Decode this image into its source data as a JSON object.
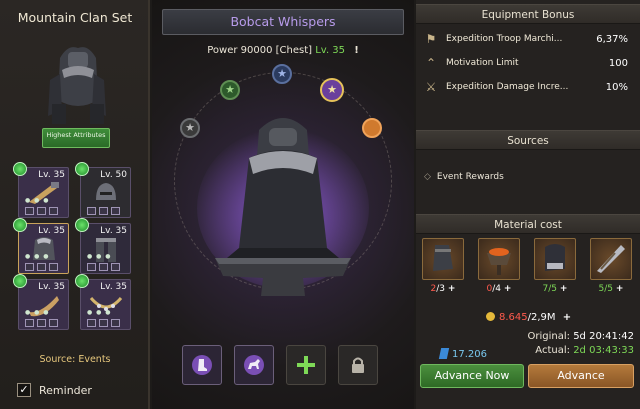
{
  "left": {
    "title": "Mountain Clan Set",
    "highest_attributes": "Highest Attributes",
    "slots": [
      {
        "level": "Lv. 35"
      },
      {
        "level": "Lv. 50"
      },
      {
        "level": "Lv. 35"
      },
      {
        "level": "Lv. 35"
      },
      {
        "level": "Lv. 35"
      },
      {
        "level": "Lv. 35"
      }
    ],
    "source": "Source: Events",
    "reminder": "Reminder"
  },
  "center": {
    "name": "Bobcat Whispers",
    "power_label": "Power 90000",
    "slot_type": "[Chest]",
    "level": "Lv. 35",
    "alert": "!"
  },
  "right": {
    "bonus_title": "Equipment Bonus",
    "bonuses": [
      {
        "name": "Expedition Troop Marchi...",
        "value": "6,37%",
        "icon": "march-icon"
      },
      {
        "name": "Motivation Limit",
        "value": "100",
        "icon": "chevron-icon"
      },
      {
        "name": "Expedition Damage Incre...",
        "value": "10%",
        "icon": "crossed-swords-icon"
      }
    ],
    "sources_title": "Sources",
    "sources": [
      "Event Rewards"
    ],
    "material_title": "Material cost",
    "materials": [
      {
        "have": "2",
        "need": "/3",
        "ok": false
      },
      {
        "have": "0",
        "need": "/4",
        "ok": false
      },
      {
        "have": "7",
        "need": "/5",
        "ok": true
      },
      {
        "have": "5",
        "need": "/5",
        "ok": true
      }
    ],
    "gold_have": "8.645",
    "gold_need": "/2,9M",
    "original_label": "Original:",
    "original_time": "5d 20:41:42",
    "actual_label": "Actual:",
    "actual_time": "2d 03:43:33",
    "gems": "17.206",
    "advance_now": "Advance Now",
    "advance": "Advance"
  }
}
